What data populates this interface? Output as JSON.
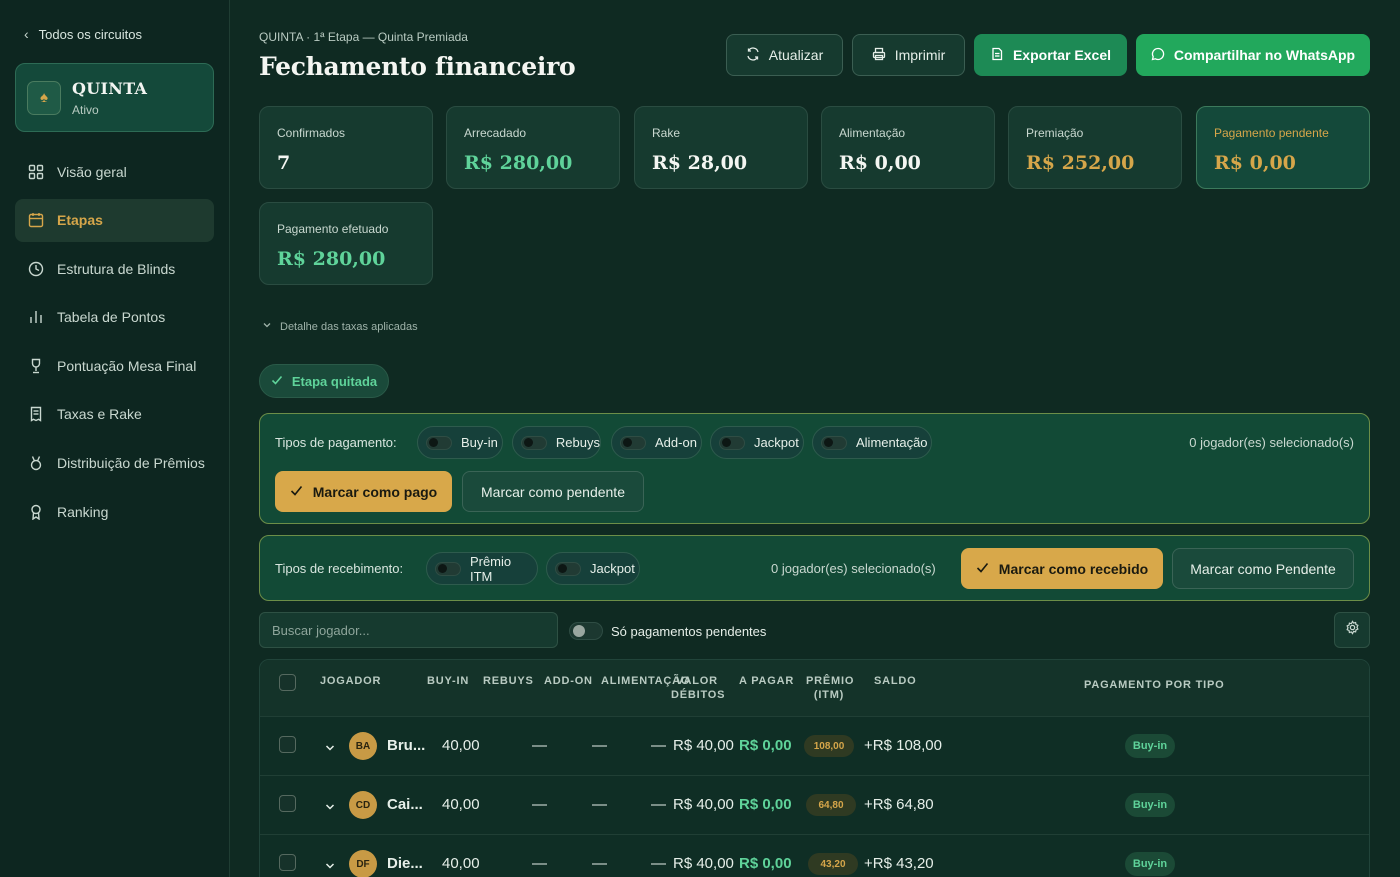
{
  "sidebar": {
    "back_label": "Todos os circuitos",
    "circuit": {
      "name": "QUINTA",
      "status": "Ativo"
    },
    "items": [
      {
        "label": "Visão geral",
        "icon": "grid-icon"
      },
      {
        "label": "Etapas",
        "icon": "calendar-icon"
      },
      {
        "label": "Estrutura de Blinds",
        "icon": "clock-icon"
      },
      {
        "label": "Tabela de Pontos",
        "icon": "bar-chart-icon"
      },
      {
        "label": "Pontuação Mesa Final",
        "icon": "trophy-icon"
      },
      {
        "label": "Taxas e Rake",
        "icon": "receipt-icon"
      },
      {
        "label": "Distribuição de Prêmios",
        "icon": "medal-icon"
      },
      {
        "label": "Ranking",
        "icon": "award-icon"
      }
    ],
    "active_item": "Etapas"
  },
  "header": {
    "breadcrumb": "QUINTA · 1ª Etapa — Quinta Premiada",
    "title": "Fechamento financeiro",
    "buttons": {
      "refresh": "Atualizar",
      "print": "Imprimir",
      "export": "Exportar Excel",
      "whatsapp": "Compartilhar no WhatsApp"
    }
  },
  "stats": [
    {
      "label": "Confirmados",
      "value": "7"
    },
    {
      "label": "Arrecadado",
      "value": "R$ 280,00"
    },
    {
      "label": "Rake",
      "value": "R$ 28,00"
    },
    {
      "label": "Alimentação",
      "value": "R$ 0,00"
    },
    {
      "label": "Premiação",
      "value": "R$ 252,00"
    },
    {
      "label": "Pagamento pendente",
      "value": "R$ 0,00"
    },
    {
      "label": "Pagamento efetuado",
      "value": "R$ 280,00"
    }
  ],
  "fees_toggle": "Detalhe das taxas aplicadas",
  "settled_badge": "Etapa quitada",
  "payment_panel": {
    "label": "Tipos de pagamento:",
    "types": [
      "Buy-in",
      "Rebuys",
      "Add-on",
      "Jackpot",
      "Alimentação"
    ],
    "selected_count": "0 jogador(es) selecionado(s)",
    "mark_paid": "Marcar como pago",
    "mark_pending": "Marcar como pendente"
  },
  "receipt_panel": {
    "label": "Tipos de recebimento:",
    "types": [
      "Prêmio ITM",
      "Jackpot"
    ],
    "selected_count": "0 jogador(es) selecionado(s)",
    "mark_received": "Marcar como recebido",
    "mark_pending": "Marcar como Pendente"
  },
  "filters": {
    "search_placeholder": "Buscar jogador...",
    "only_pending": "Só pagamentos pendentes"
  },
  "table": {
    "headers": {
      "player": "JOGADOR",
      "buyin": "BUY-IN",
      "rebuys": "REBUYS",
      "addon": "ADD-ON",
      "food": "ALIMENTAÇÃO",
      "debits_1": "VALOR",
      "debits_2": "DÉBITOS",
      "to_pay": "A PAGAR",
      "prize_1": "PRÊMIO",
      "prize_2": "(ITM)",
      "balance": "SALDO",
      "payment_by_type": "PAGAMENTO POR TIPO"
    },
    "rows": [
      {
        "initials": "BA",
        "name": "Bru...",
        "buyin": "40,00",
        "rebuys": "—",
        "addon": "—",
        "food": "—",
        "debits": "R$ 40,00",
        "to_pay": "R$ 0,00",
        "prize": "108,00",
        "balance": "+R$ 108,00",
        "type": "Buy-in"
      },
      {
        "initials": "CD",
        "name": "Cai...",
        "buyin": "40,00",
        "rebuys": "—",
        "addon": "—",
        "food": "—",
        "debits": "R$ 40,00",
        "to_pay": "R$ 0,00",
        "prize": "64,80",
        "balance": "+R$ 64,80",
        "type": "Buy-in"
      },
      {
        "initials": "DF",
        "name": "Die...",
        "buyin": "40,00",
        "rebuys": "—",
        "addon": "—",
        "food": "—",
        "debits": "R$ 40,00",
        "to_pay": "R$ 0,00",
        "prize": "43,20",
        "balance": "+R$ 43,20",
        "type": "Buy-in"
      }
    ]
  },
  "colors": {
    "background": "#0f2a22",
    "accent_gold": "#d6a64a",
    "accent_green": "#5fd39a",
    "whatsapp_green": "#22a85c"
  }
}
